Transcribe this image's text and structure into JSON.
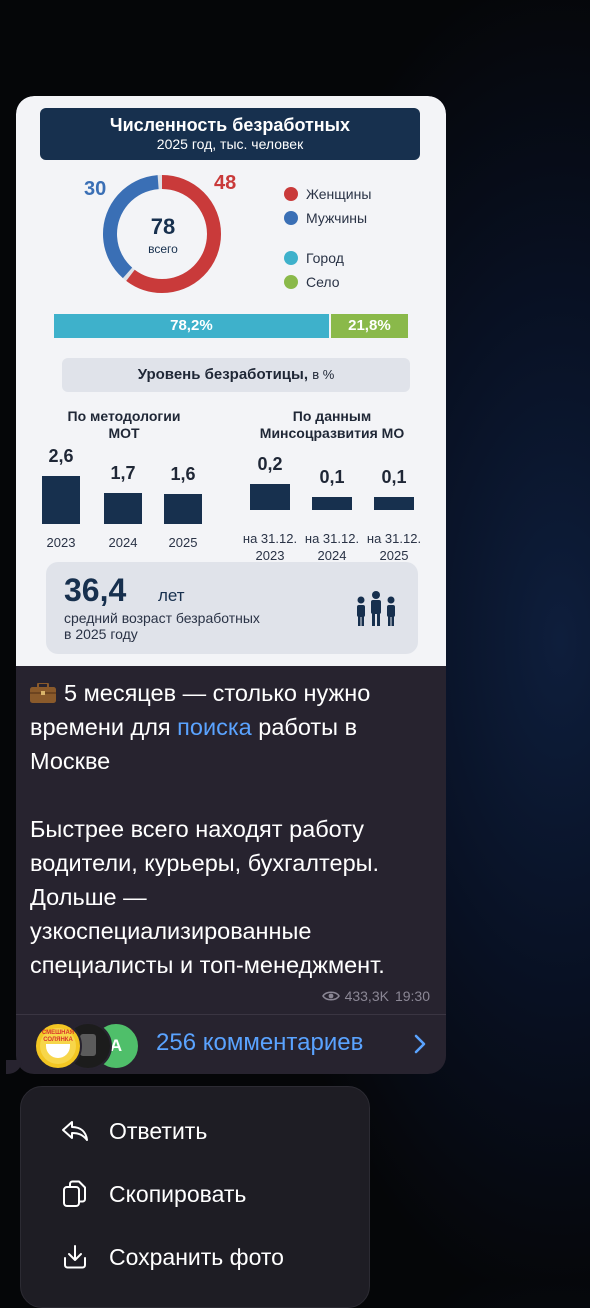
{
  "infographic": {
    "title": "Численность безработных",
    "subtitle": "2025 год, тыс. человек",
    "donut": {
      "total": "78",
      "total_label": "всего",
      "women_value": "48",
      "men_value": "30",
      "women": 48,
      "men": 30
    },
    "legend": {
      "women": "Женщины",
      "men": "Мужчины",
      "city": "Город",
      "village": "Село"
    },
    "city_bar": {
      "city_label": "78,2%",
      "village_label": "21,8%",
      "city": 78.2,
      "village": 21.8
    },
    "rate_header": "Уровень безработицы,",
    "rate_unit": "в %",
    "left_group": {
      "title_line1": "По методологии",
      "title_line2": "МОТ",
      "items": [
        {
          "value": "2,6",
          "label": "2023",
          "v": 2.6
        },
        {
          "value": "1,7",
          "label": "2024",
          "v": 1.7
        },
        {
          "value": "1,6",
          "label": "2025",
          "v": 1.6
        }
      ]
    },
    "right_group": {
      "title_line1": "По данным",
      "title_line2": "Минсоцразвития МО",
      "items": [
        {
          "value": "0,2",
          "label1": "на 31.12.",
          "label2": "2023",
          "v": 0.2
        },
        {
          "value": "0,1",
          "label1": "на 31.12.",
          "label2": "2024",
          "v": 0.1
        },
        {
          "value": "0,1",
          "label1": "на 31.12.",
          "label2": "2025",
          "v": 0.1
        }
      ]
    },
    "age": {
      "value": "36,4",
      "unit": "лет",
      "desc_line1": "средний возраст безработных",
      "desc_line2": "в 2025 году"
    },
    "colors": {
      "women": "#c93a3a",
      "men": "#3a6fb5",
      "city": "#3eb1cb",
      "village": "#8ab94a",
      "navy": "#17304e"
    }
  },
  "post": {
    "p1_before": "5 месяцев — столько нужно времени для ",
    "p1_link": "поиска",
    "p1_after": " работы в Москве",
    "p2": "Быстрее всего находят работу водители, курьеры, бухгалтеры. Дольше — узкоспециализированные специалисты и топ-менеджмент.",
    "icon": "briefcase-icon",
    "views": "433,3K",
    "time": "19:30"
  },
  "comments": {
    "count_label": "256 комментариев",
    "avatar_letter": "А",
    "avatar1_text_line1": "СМЕШНАЯ",
    "avatar1_text_line2": "СОЛЯНКА"
  },
  "menu": {
    "reply": "Ответить",
    "copy": "Скопировать",
    "save": "Сохранить фото"
  }
}
